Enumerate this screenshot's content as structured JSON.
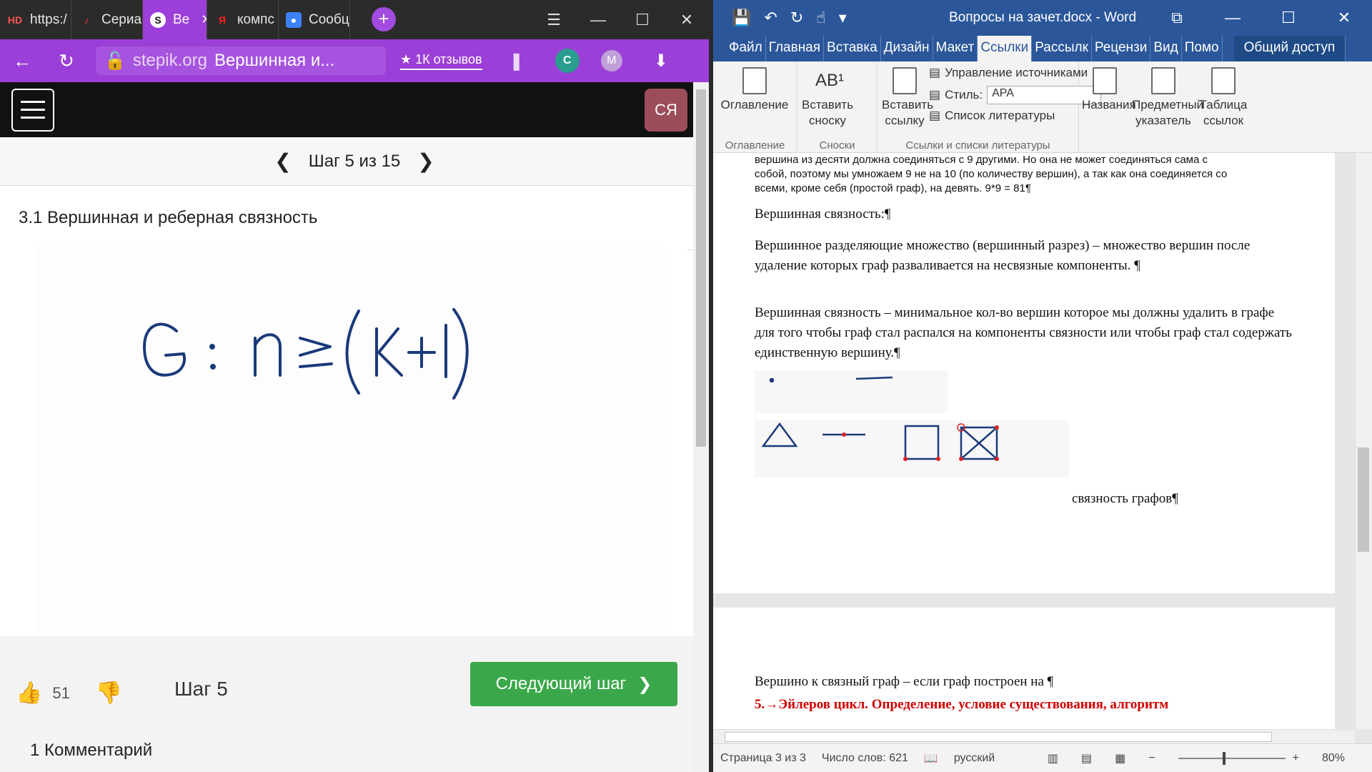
{
  "browser": {
    "tabs": [
      {
        "label": "https:/",
        "active": false
      },
      {
        "label": "Сериа",
        "active": false
      },
      {
        "label": "Ве",
        "active": true
      },
      {
        "label": "компс",
        "active": false
      },
      {
        "label": "Сообц",
        "active": false
      }
    ],
    "new_tab": "+",
    "address": {
      "domain": "stepik.org",
      "page_title": "Вершинная и...",
      "reviews": "★ 1К отзывов"
    },
    "avatar_m": "M",
    "user_badge": "СЯ",
    "step": {
      "label": "Шаг 5 из 15"
    },
    "lesson_title": "3.1 Вершинная и реберная связность",
    "footer": {
      "likes": "51",
      "step_label": "Шаг 5",
      "next_button": "Следующий шаг",
      "comments": "1  Комментарий"
    }
  },
  "word": {
    "title": "Вопросы на зачет.docx - Word",
    "tabs": [
      "Файл",
      "Главная",
      "Вставка",
      "Дизайн",
      "Макет",
      "Ссылки",
      "Рассылк",
      "Рецензи",
      "Вид",
      "Помо"
    ],
    "active_tab": "Ссылки",
    "share": "Общий доступ",
    "ribbon": {
      "toc": "Оглавление",
      "toc_group": "Оглавление",
      "footnote": "Вставить сноску",
      "footnote_group": "Сноски",
      "citation": "Вставить ссылку",
      "manage_sources": "Управление источниками",
      "style_label": "Стиль:",
      "style_value": "APA",
      "bibliography": "Список литературы",
      "citations_group": "Ссылки и списки литературы",
      "captions": "Названия",
      "index": "Предметный указатель",
      "toa": "Таблица ссылок"
    },
    "document": {
      "small_lines": [
        "вершина из десяти должна соединяться с 9 другими. Но она не может соединяться сама с",
        "собой, поэтому мы умножаем 9 не на 10 (по количеству вершин), а так как она соединяется со",
        "всеми, кроме себя (простой граф), на девять. 9*9 = 81¶"
      ],
      "heading": "Вершинная связность:¶",
      "para1": "Вершинное разделяющие множество (вершинный разрез) – множество вершин после удаление которых граф разваливается на несвязные компоненты. ¶",
      "para2": "Вершинная связность – минимальное кол-во вершин которое мы должны удалить в графе для того чтобы граф стал распался на компоненты связности или чтобы граф стал содержать единственную вершину.¶",
      "image_caption": "связность графов¶",
      "page2_line": "Вершино к связный граф – если граф построен на ¶",
      "page2_red": "5.→Эйлеров цикл. Определение, условие существования, алгоритм"
    },
    "status": {
      "page": "Страница 3 из 3",
      "words": "Число слов: 621",
      "language": "русский",
      "zoom": "80%"
    }
  }
}
